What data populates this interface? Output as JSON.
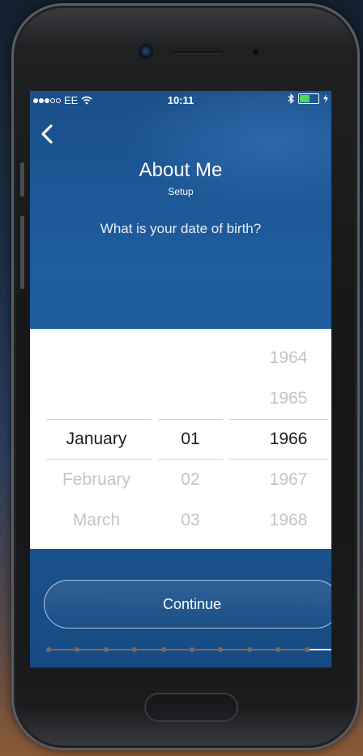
{
  "status_bar": {
    "carrier": "EE",
    "time": "10:11",
    "signal_bars_filled": 3,
    "signal_bars_total": 5,
    "battery_level": 0.5
  },
  "nav": {
    "back_icon": "chevron-left-icon"
  },
  "header": {
    "title": "About Me",
    "subtitle": "Setup",
    "question": "What is your date of birth?"
  },
  "picker": {
    "months": [
      "January",
      "February",
      "March"
    ],
    "days": [
      "01",
      "02",
      "03"
    ],
    "years": [
      "1964",
      "1965",
      "1966",
      "1967",
      "1968"
    ],
    "selected": {
      "month": "January",
      "day": "01",
      "year": "1966"
    }
  },
  "actions": {
    "continue_label": "Continue"
  },
  "progress": {
    "total_steps": 11,
    "current_step": 11
  },
  "colors": {
    "accent_blue": "#1f5d9e",
    "battery_green": "#4cd964",
    "picker_selected": "#1d1d1d",
    "picker_unselected": "#c4c4c4"
  }
}
